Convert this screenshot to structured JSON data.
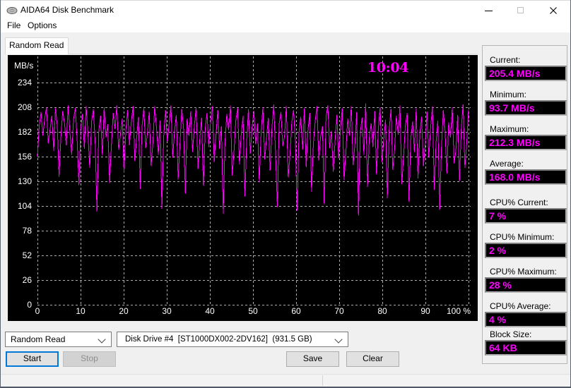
{
  "window": {
    "title": "AIDA64 Disk Benchmark"
  },
  "menu": {
    "items": [
      "File",
      "Options"
    ]
  },
  "tab": {
    "label": "Random Read"
  },
  "chart_data": {
    "type": "line",
    "unit": "MB/s",
    "timer": "10:04",
    "y_ticks": [
      234,
      208,
      182,
      156,
      130,
      104,
      78,
      52,
      26,
      0
    ],
    "x_ticks": [
      "0",
      "10",
      "20",
      "30",
      "40",
      "50",
      "60",
      "70",
      "80",
      "90",
      "100 %"
    ],
    "ylim": [
      0,
      260
    ],
    "xlim_percent": [
      0,
      100
    ],
    "grid": true,
    "legend": "none",
    "series": [
      {
        "name": "Random Read speed",
        "color": "#ff00ff",
        "values": [
          156,
          189,
          203,
          178,
          196,
          208,
          170,
          185,
          199,
          162,
          207,
          188,
          135,
          177,
          204,
          191,
          168,
          210,
          182,
          158,
          195,
          207,
          173,
          126,
          186,
          201,
          164,
          209,
          180,
          144,
          193,
          206,
          171,
          98,
          183,
          199,
          157,
          208,
          176,
          190,
          128,
          167,
          202,
          185,
          210,
          163,
          179,
          196,
          139,
          184,
          205,
          168,
          192,
          209,
          151,
          176,
          198,
          122,
          188,
          207,
          165,
          181,
          203,
          146,
          170,
          209,
          186,
          158,
          194,
          101,
          178,
          205,
          172,
          190,
          210,
          155,
          183,
          200,
          132,
          168,
          206,
          187,
          117,
          196,
          178,
          204,
          161,
          189,
          208,
          143,
          174,
          197,
          125,
          185,
          202,
          166,
          193,
          209,
          150,
          179,
          205,
          164,
          188,
          96,
          171,
          201,
          184,
          210,
          136,
          162,
          195,
          207,
          148,
          180,
          199,
          114,
          173,
          206,
          159,
          187,
          204,
          169,
          191,
          129,
          182,
          208,
          153,
          175,
          197,
          141,
          186,
          211,
          160,
          103,
          190,
          203,
          167,
          178,
          209,
          134,
          157,
          192,
          205,
          172,
          99,
          181,
          198,
          163,
          207,
          145,
          184,
          202,
          119,
          170,
          194,
          209,
          152,
          177,
          188,
          106,
          198,
          210,
          165,
          183,
          140,
          172,
          200,
          154,
          185,
          207,
          131,
          160,
          196,
          178,
          209,
          147,
          169,
          203,
          94,
          182,
          197,
          158,
          212,
          124,
          176,
          191,
          166,
          204,
          137,
          186,
          208,
          150,
          173,
          195,
          112,
          184,
          206,
          142,
          164,
          199,
          179,
          210,
          127,
          156,
          189,
          202,
          108,
          175,
          193,
          161,
          207,
          133,
          180,
          198,
          146,
          168,
          203,
          155,
          187,
          209,
          121,
          171,
          194,
          100,
          165,
          205,
          183,
          138,
          192,
          176,
          208,
          149,
          162,
          200,
          130,
          186,
          211,
          144,
          170,
          205
        ]
      }
    ]
  },
  "stats": [
    {
      "label": "Current:",
      "value": "205.4 MB/s"
    },
    {
      "label": "Minimum:",
      "value": "93.7 MB/s"
    },
    {
      "label": "Maximum:",
      "value": "212.3 MB/s"
    },
    {
      "label": "Average:",
      "value": "168.0 MB/s"
    },
    {
      "label": "CPU% Current:",
      "value": "7 %"
    },
    {
      "label": "CPU% Minimum:",
      "value": "2 %"
    },
    {
      "label": "CPU% Maximum:",
      "value": "28 %"
    },
    {
      "label": "CPU% Average:",
      "value": "4 %"
    },
    {
      "label": "Block Size:",
      "value": "64 KB"
    }
  ],
  "controls": {
    "benchmark_select": {
      "value": "Random Read"
    },
    "drive_select": {
      "value": "Disk Drive #4  [ST1000DX002-2DV162]  (931.5 GB)"
    },
    "buttons": [
      {
        "label": "Start",
        "state": "focused"
      },
      {
        "label": "Stop",
        "state": "disabled"
      },
      {
        "label": "Save",
        "state": "normal"
      },
      {
        "label": "Clear",
        "state": "normal"
      }
    ]
  }
}
